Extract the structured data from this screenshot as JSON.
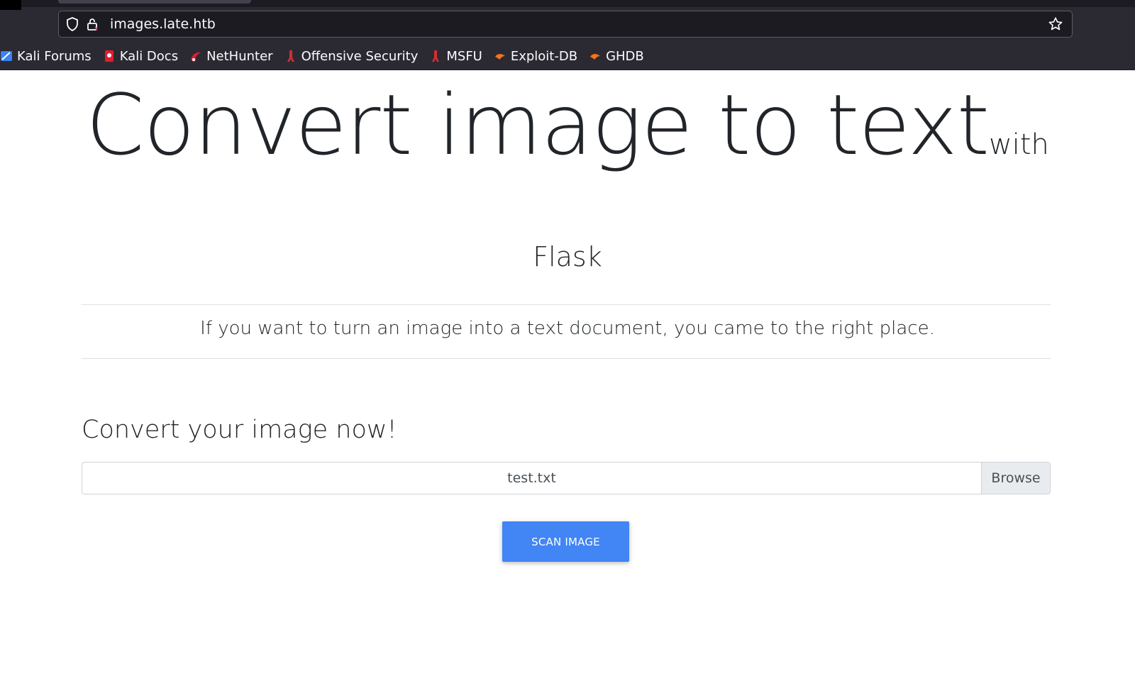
{
  "browser": {
    "url": "images.late.htb",
    "bookmarks": [
      {
        "label": "Kali Forums",
        "icon": "kali-forums-icon",
        "color": "#3b82f6"
      },
      {
        "label": "Kali Docs",
        "icon": "kali-docs-icon",
        "color": "#e11d2e"
      },
      {
        "label": "NetHunter",
        "icon": "nethunter-icon",
        "color": "#e11d2e"
      },
      {
        "label": "Offensive Security",
        "icon": "offensive-security-icon",
        "color": "#d32f2f"
      },
      {
        "label": "MSFU",
        "icon": "msfu-icon",
        "color": "#d32f2f"
      },
      {
        "label": "Exploit-DB",
        "icon": "exploit-db-icon",
        "color": "#f97316"
      },
      {
        "label": "GHDB",
        "icon": "ghdb-icon",
        "color": "#f97316"
      }
    ]
  },
  "page": {
    "title_main": "Convert image to text",
    "title_suffix": "with",
    "subtitle": "Flask",
    "lead": "If you want to turn an image into a text document, you came to the right place.",
    "form_heading": "Convert your image now!",
    "file_name": "test.txt",
    "browse_label": "Browse",
    "scan_label": "SCAN IMAGE"
  },
  "colors": {
    "chrome_bg": "#2b2a33",
    "url_bar_bg": "#1c1b22",
    "button_primary": "#4285f4",
    "text": "#212529"
  }
}
